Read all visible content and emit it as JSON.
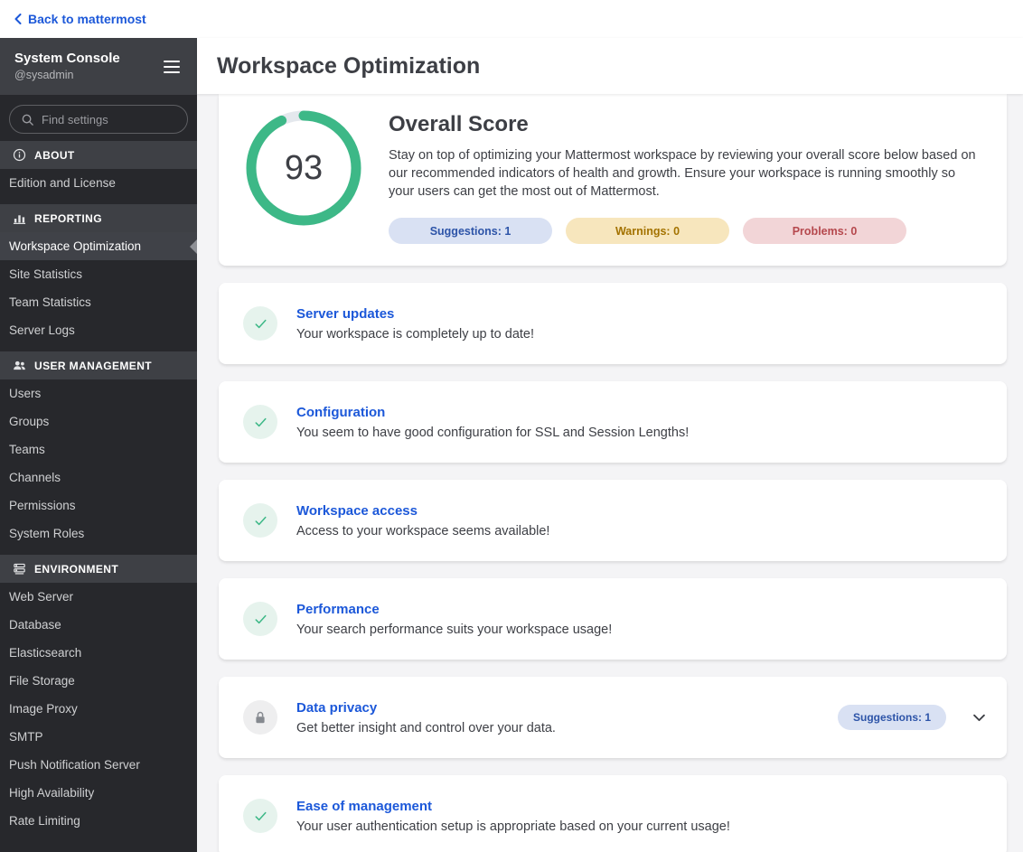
{
  "top_bar": {
    "back_link": "Back to mattermost"
  },
  "sidebar": {
    "title": "System Console",
    "subtitle": "@sysadmin",
    "search_placeholder": "Find settings",
    "sections": [
      {
        "label": "ABOUT",
        "icon": "info-icon",
        "items": [
          {
            "label": "Edition and License"
          }
        ]
      },
      {
        "label": "REPORTING",
        "icon": "chart-icon",
        "items": [
          {
            "label": "Workspace Optimization",
            "selected": true
          },
          {
            "label": "Site Statistics"
          },
          {
            "label": "Team Statistics"
          },
          {
            "label": "Server Logs"
          }
        ]
      },
      {
        "label": "USER MANAGEMENT",
        "icon": "users-icon",
        "items": [
          {
            "label": "Users"
          },
          {
            "label": "Groups"
          },
          {
            "label": "Teams"
          },
          {
            "label": "Channels"
          },
          {
            "label": "Permissions"
          },
          {
            "label": "System Roles"
          }
        ]
      },
      {
        "label": "ENVIRONMENT",
        "icon": "environment-icon",
        "items": [
          {
            "label": "Web Server"
          },
          {
            "label": "Database"
          },
          {
            "label": "Elasticsearch"
          },
          {
            "label": "File Storage"
          },
          {
            "label": "Image Proxy"
          },
          {
            "label": "SMTP"
          },
          {
            "label": "Push Notification Server"
          },
          {
            "label": "High Availability"
          },
          {
            "label": "Rate Limiting"
          }
        ]
      }
    ]
  },
  "header": {
    "title": "Workspace Optimization"
  },
  "overview": {
    "score": "93",
    "score_max": 100,
    "title": "Overall Score",
    "description": "Stay on top of optimizing your Mattermost workspace by reviewing your overall score below based on our recommended indicators of health and growth. Ensure your workspace is running smoothly so your users can get the most out of Mattermost.",
    "chips": [
      {
        "label": "Suggestions: 1",
        "type": "info"
      },
      {
        "label": "Warnings: 0",
        "type": "warning"
      },
      {
        "label": "Problems: 0",
        "type": "error"
      }
    ]
  },
  "cards": [
    {
      "title": "Server updates",
      "desc": "Your workspace is completely up to date!",
      "icon": "check"
    },
    {
      "title": "Configuration",
      "desc": "You seem to have good configuration for SSL and Session Lengths!",
      "icon": "check"
    },
    {
      "title": "Workspace access",
      "desc": "Access to your workspace seems available!",
      "icon": "check"
    },
    {
      "title": "Performance",
      "desc": "Your search performance suits your workspace usage!",
      "icon": "check"
    },
    {
      "title": "Data privacy",
      "desc": "Get better insight and control over your data.",
      "icon": "lock",
      "chip": "Suggestions: 1",
      "expandable": true
    },
    {
      "title": "Ease of management",
      "desc": "Your user authentication setup is appropriate based on your current usage!",
      "icon": "check"
    }
  ],
  "colors": {
    "accent_blue": "#1c58d9",
    "success_green": "#3db887",
    "sidebar_bg": "#27282c",
    "sidebar_section_bg": "#3e4045",
    "chip_info_bg": "#d9e1f3",
    "chip_warning_bg": "#f7e6bd",
    "chip_error_bg": "#f2d5d7"
  }
}
